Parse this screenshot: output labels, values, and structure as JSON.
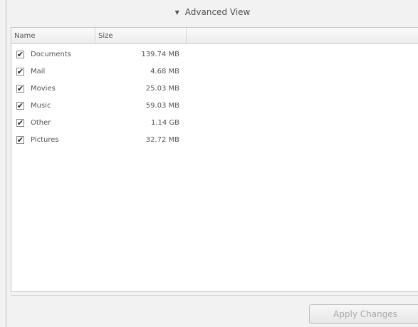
{
  "expander": {
    "arrow_icon": "triangle-down-icon",
    "label": "Advanced View"
  },
  "tree": {
    "columns": [
      "Name",
      "Size"
    ],
    "rows": [
      {
        "name": "Documents",
        "size": "139.74 MB",
        "checked": true
      },
      {
        "name": "Mail",
        "size": "4.68 MB",
        "checked": true
      },
      {
        "name": "Movies",
        "size": "25.03 MB",
        "checked": true
      },
      {
        "name": "Music",
        "size": "59.03 MB",
        "checked": true
      },
      {
        "name": "Other",
        "size": "1.14 GB",
        "checked": true
      },
      {
        "name": "Pictures",
        "size": "32.72 MB",
        "checked": true
      }
    ]
  },
  "footer": {
    "apply_label": "Apply Changes",
    "apply_enabled": false
  }
}
